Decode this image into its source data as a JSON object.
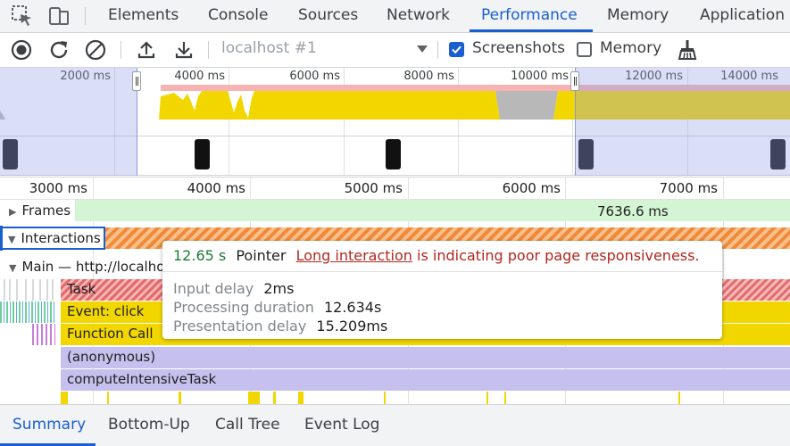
{
  "tabs": {
    "elements": "Elements",
    "console": "Console",
    "sources": "Sources",
    "network": "Network",
    "performance": "Performance",
    "memory": "Memory",
    "application": "Application"
  },
  "toolbar": {
    "record_icon": "record-icon",
    "reload_icon": "reload-icon",
    "clear_icon": "clear-icon",
    "upload_icon": "upload-icon",
    "download_icon": "download-icon",
    "target_select": "localhost #1",
    "screenshots_label": "Screenshots",
    "screenshots_checked": true,
    "memory_label": "Memory",
    "memory_checked": false,
    "gc_icon": "broom-icon"
  },
  "overview": {
    "ticks": [
      "2000 ms",
      "4000 ms",
      "6000 ms",
      "8000 ms",
      "10000 ms",
      "12000 ms",
      "14000 ms"
    ]
  },
  "ruler": {
    "ticks": [
      "3000 ms",
      "4000 ms",
      "5000 ms",
      "6000 ms",
      "7000 ms"
    ]
  },
  "tracks": {
    "frames": {
      "label": "Frames",
      "duration": "7636.6 ms"
    },
    "interactions": {
      "label": "Interactions"
    },
    "main": {
      "label": "Main — http://localho"
    },
    "bars": {
      "task": "Task",
      "event": "Event: click",
      "function_call": "Function Call",
      "anonymous": "(anonymous)",
      "compute": "computeIntensiveTask"
    }
  },
  "tooltip": {
    "time": "12.65 s",
    "type": "Pointer",
    "link": "Long interaction",
    "message": " is indicating poor page responsiveness.",
    "input_delay_label": "Input delay",
    "input_delay_value": "2ms",
    "processing_label": "Processing duration",
    "processing_value": "12.634s",
    "presentation_label": "Presentation delay",
    "presentation_value": "15.209ms"
  },
  "bottom_tabs": {
    "summary": "Summary",
    "bottom_up": "Bottom-Up",
    "call_tree": "Call Tree",
    "event_log": "Event Log"
  },
  "colors": {
    "accent": "#1a5fd0",
    "warning_link": "#b3261e",
    "time_green": "#1e7a34",
    "cpu_yellow": "#f2d600",
    "frames_green": "#d4f5d4",
    "purple_bar": "#c6c0ee"
  }
}
